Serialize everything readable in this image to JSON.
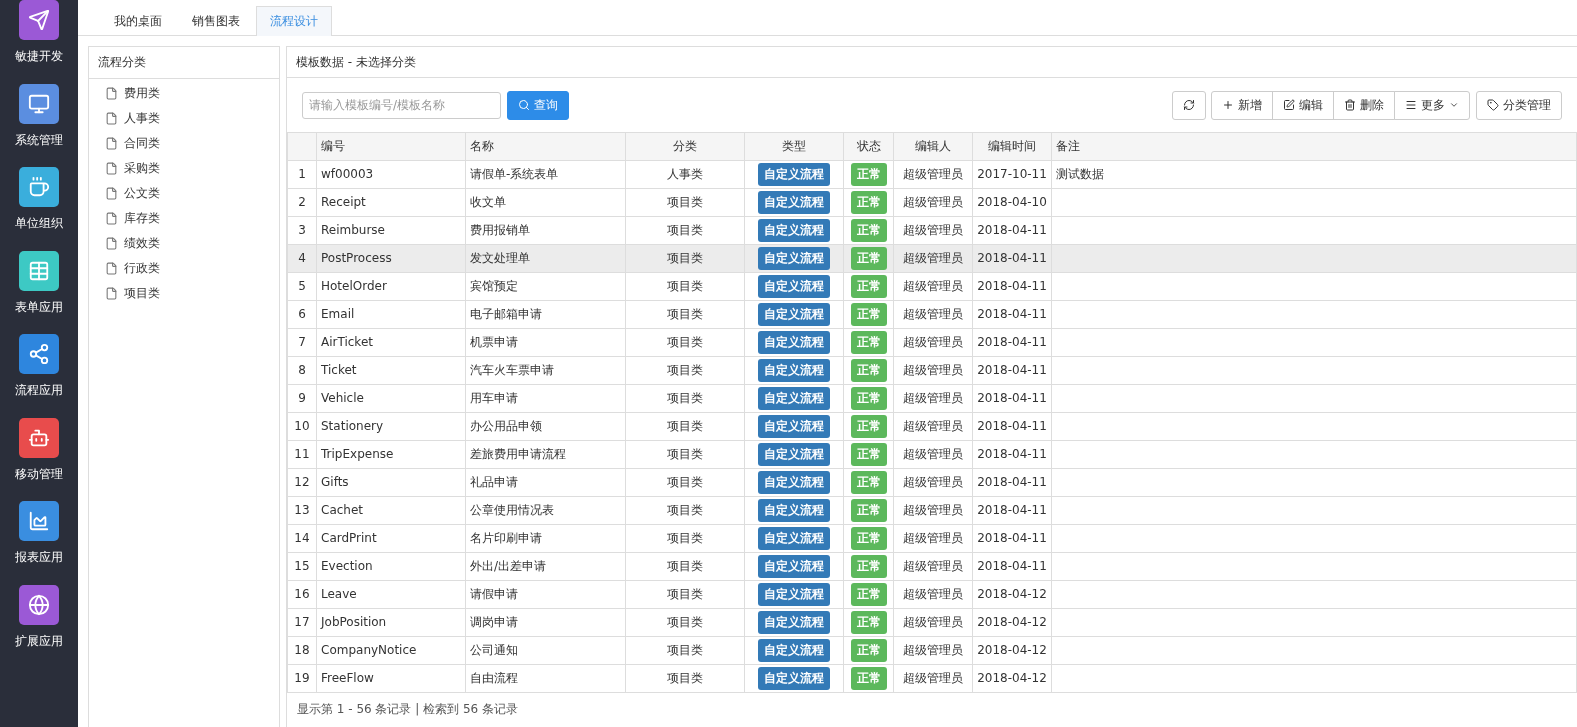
{
  "sidebar": {
    "items": [
      {
        "label": "敏捷开发",
        "color": "#9b59d6"
      },
      {
        "label": "系统管理",
        "color": "#5b8ee0"
      },
      {
        "label": "单位组织",
        "color": "#3aaedc"
      },
      {
        "label": "表单应用",
        "color": "#3dc9c4"
      },
      {
        "label": "流程应用",
        "color": "#2e86de"
      },
      {
        "label": "移动管理",
        "color": "#e84c4c"
      },
      {
        "label": "报表应用",
        "color": "#3a8ee0"
      },
      {
        "label": "扩展应用",
        "color": "#9b59d6"
      }
    ]
  },
  "tabs": [
    {
      "label": "我的桌面",
      "selected": false
    },
    {
      "label": "销售图表",
      "selected": false
    },
    {
      "label": "流程设计",
      "selected": true
    }
  ],
  "category_panel": {
    "title": "流程分类",
    "items": [
      "费用类",
      "人事类",
      "合同类",
      "采购类",
      "公文类",
      "库存类",
      "绩效类",
      "行政类",
      "项目类"
    ]
  },
  "template_panel": {
    "title": "模板数据 - 未选择分类",
    "search": {
      "placeholder": "请输入模板编号/模板名称",
      "button": "查询"
    },
    "toolbar": [
      {
        "kind": "refresh"
      },
      {
        "kind": "add",
        "label": "新增"
      },
      {
        "kind": "edit",
        "label": "编辑"
      },
      {
        "kind": "delete",
        "label": "删除"
      },
      {
        "kind": "more",
        "label": "更多"
      },
      {
        "kind": "tag",
        "label": "分类管理"
      }
    ],
    "table": {
      "columns": [
        "编号",
        "名称",
        "分类",
        "类型",
        "状态",
        "编辑人",
        "编辑时间",
        "备注"
      ],
      "rows": [
        {
          "index": "1",
          "code": "wf00003",
          "name": "请假单-系统表单",
          "category": "人事类",
          "type": "自定义流程",
          "status": "正常",
          "editor": "超级管理员",
          "time": "2017-10-11",
          "note": "测试数据",
          "selected": false
        },
        {
          "index": "2",
          "code": "Receipt",
          "name": "收文单",
          "category": "项目类",
          "type": "自定义流程",
          "status": "正常",
          "editor": "超级管理员",
          "time": "2018-04-10",
          "selected": false
        },
        {
          "index": "3",
          "code": "Reimburse",
          "name": "费用报销单",
          "category": "项目类",
          "type": "自定义流程",
          "status": "正常",
          "editor": "超级管理员",
          "time": "2018-04-11",
          "selected": false
        },
        {
          "index": "4",
          "code": "PostProcess",
          "name": "发文处理单",
          "category": "项目类",
          "type": "自定义流程",
          "status": "正常",
          "editor": "超级管理员",
          "time": "2018-04-11",
          "selected": true
        },
        {
          "index": "5",
          "code": "HotelOrder",
          "name": "宾馆预定",
          "category": "项目类",
          "type": "自定义流程",
          "status": "正常",
          "editor": "超级管理员",
          "time": "2018-04-11",
          "selected": false
        },
        {
          "index": "6",
          "code": "Email",
          "name": "电子邮箱申请",
          "category": "项目类",
          "type": "自定义流程",
          "status": "正常",
          "editor": "超级管理员",
          "time": "2018-04-11",
          "selected": false
        },
        {
          "index": "7",
          "code": "AirTicket",
          "name": "机票申请",
          "category": "项目类",
          "type": "自定义流程",
          "status": "正常",
          "editor": "超级管理员",
          "time": "2018-04-11",
          "selected": false
        },
        {
          "index": "8",
          "code": "Ticket",
          "name": "汽车火车票申请",
          "category": "项目类",
          "type": "自定义流程",
          "status": "正常",
          "editor": "超级管理员",
          "time": "2018-04-11",
          "selected": false
        },
        {
          "index": "9",
          "code": "Vehicle",
          "name": "用车申请",
          "category": "项目类",
          "type": "自定义流程",
          "status": "正常",
          "editor": "超级管理员",
          "time": "2018-04-11",
          "selected": false
        },
        {
          "index": "10",
          "code": "Stationery",
          "name": "办公用品申领",
          "category": "项目类",
          "type": "自定义流程",
          "status": "正常",
          "editor": "超级管理员",
          "time": "2018-04-11",
          "selected": false
        },
        {
          "index": "11",
          "code": "TripExpense",
          "name": "差旅费用申请流程",
          "category": "项目类",
          "type": "自定义流程",
          "status": "正常",
          "editor": "超级管理员",
          "time": "2018-04-11",
          "selected": false
        },
        {
          "index": "12",
          "code": "Gifts",
          "name": "礼品申请",
          "category": "项目类",
          "type": "自定义流程",
          "status": "正常",
          "editor": "超级管理员",
          "time": "2018-04-11",
          "selected": false
        },
        {
          "index": "13",
          "code": "Cachet",
          "name": "公章使用情况表",
          "category": "项目类",
          "type": "自定义流程",
          "status": "正常",
          "editor": "超级管理员",
          "time": "2018-04-11",
          "selected": false
        },
        {
          "index": "14",
          "code": "CardPrint",
          "name": "名片印刷申请",
          "category": "项目类",
          "type": "自定义流程",
          "status": "正常",
          "editor": "超级管理员",
          "time": "2018-04-11",
          "selected": false
        },
        {
          "index": "15",
          "code": "Evection",
          "name": "外出/出差申请",
          "category": "项目类",
          "type": "自定义流程",
          "status": "正常",
          "editor": "超级管理员",
          "time": "2018-04-11",
          "selected": false
        },
        {
          "index": "16",
          "code": "Leave",
          "name": "请假申请",
          "category": "项目类",
          "type": "自定义流程",
          "status": "正常",
          "editor": "超级管理员",
          "time": "2018-04-12",
          "selected": false
        },
        {
          "index": "17",
          "code": "JobPosition",
          "name": "调岗申请",
          "category": "项目类",
          "type": "自定义流程",
          "status": "正常",
          "editor": "超级管理员",
          "time": "2018-04-12",
          "selected": false
        },
        {
          "index": "18",
          "code": "CompanyNotice",
          "name": "公司通知",
          "category": "项目类",
          "type": "自定义流程",
          "status": "正常",
          "editor": "超级管理员",
          "time": "2018-04-12",
          "selected": false
        },
        {
          "index": "19",
          "code": "FreeFlow",
          "name": "自由流程",
          "category": "项目类",
          "type": "自定义流程",
          "status": "正常",
          "editor": "超级管理员",
          "time": "2018-04-12",
          "selected": false
        }
      ]
    },
    "footer": "显示第 1 - 56 条记录 | 检索到 56 条记录"
  }
}
